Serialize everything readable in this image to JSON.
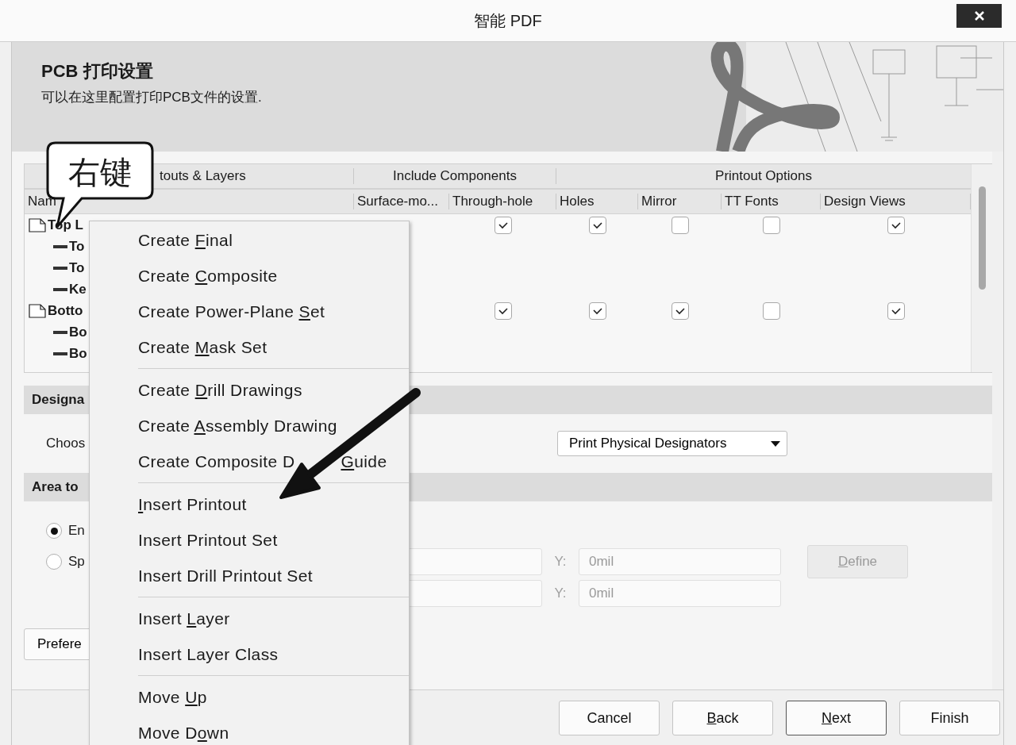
{
  "window": {
    "title": "智能 PDF"
  },
  "banner": {
    "title": "PCB 打印设置",
    "subtitle": "可以在这里配置打印PCB文件的设置."
  },
  "table": {
    "groups": [
      "touts & Layers",
      "Include Components",
      "Printout Options"
    ],
    "columns": [
      "Nam",
      "Surface-mo...",
      "Through-hole",
      "Holes",
      "Mirror",
      "TT Fonts",
      "Design Views"
    ],
    "rows": [
      {
        "name": "Top L",
        "checks": [
          {
            "checked": true
          },
          {
            "checked": true
          },
          {
            "checked": false
          },
          {
            "checked": false
          },
          {
            "checked": true
          }
        ],
        "children": [
          {
            "name": "To"
          },
          {
            "name": "To"
          },
          {
            "name": "Ke"
          }
        ]
      },
      {
        "name": "Botto",
        "checks": [
          {
            "checked": true
          },
          {
            "checked": true
          },
          {
            "checked": true
          },
          {
            "checked": false
          },
          {
            "checked": true
          }
        ],
        "children": [
          {
            "name": "Bo"
          },
          {
            "name": "Bo"
          }
        ]
      }
    ]
  },
  "designators": {
    "header": "Designa",
    "label": "Choos",
    "dropdown": "Print Physical Designators"
  },
  "area": {
    "header": "Area to",
    "options": [
      {
        "label": "En",
        "selected": true
      },
      {
        "label": "Sp",
        "selected": false
      }
    ],
    "fields": [
      {
        "y_label": "Y:",
        "y_value": "0mil",
        "disabled": true
      },
      {
        "y_label": "Y:",
        "y_value": "0mil",
        "disabled": true
      }
    ],
    "define": {
      "key": "D",
      "after": "efine",
      "disabled": true
    }
  },
  "preferences_button": {
    "label": "Prefere"
  },
  "buttons": [
    {
      "label": "Cancel",
      "default": false
    },
    {
      "key": "B",
      "after": "ack",
      "default": false
    },
    {
      "key": "N",
      "after": "ext",
      "default": true
    },
    {
      "label": "Finish",
      "default": false
    }
  ],
  "context_menu": [
    {
      "kind": "item",
      "before": "Create ",
      "key": "F",
      "after": "inal"
    },
    {
      "kind": "item",
      "before": "Create ",
      "key": "C",
      "after": "omposite"
    },
    {
      "kind": "item",
      "before": "Create Power-Plane ",
      "key": "S",
      "after": "et"
    },
    {
      "kind": "item",
      "before": "Create ",
      "key": "M",
      "after": "ask Set"
    },
    {
      "kind": "separator"
    },
    {
      "kind": "item",
      "before": "Create ",
      "key": "D",
      "after": "rill Drawings"
    },
    {
      "kind": "item",
      "before": "Create ",
      "key": "A",
      "after": "ssembly Drawing"
    },
    {
      "kind": "covered",
      "before": "Create Composite D",
      "key": "G",
      "after": "uide"
    },
    {
      "kind": "separator"
    },
    {
      "kind": "item",
      "key": "I",
      "after": "nsert Printout"
    },
    {
      "kind": "item",
      "label": "Insert Printout Set"
    },
    {
      "kind": "item",
      "label": "Insert Drill Printout Set"
    },
    {
      "kind": "separator"
    },
    {
      "kind": "item",
      "before": "Insert ",
      "key": "L",
      "after": "ayer"
    },
    {
      "kind": "item",
      "label": "Insert Layer Class"
    },
    {
      "kind": "separator"
    },
    {
      "kind": "item",
      "before": "Move ",
      "key": "U",
      "after": "p"
    },
    {
      "kind": "item",
      "before": "Move D",
      "key": "o",
      "after": "wn"
    }
  ],
  "annotation": {
    "callout": "右键"
  }
}
